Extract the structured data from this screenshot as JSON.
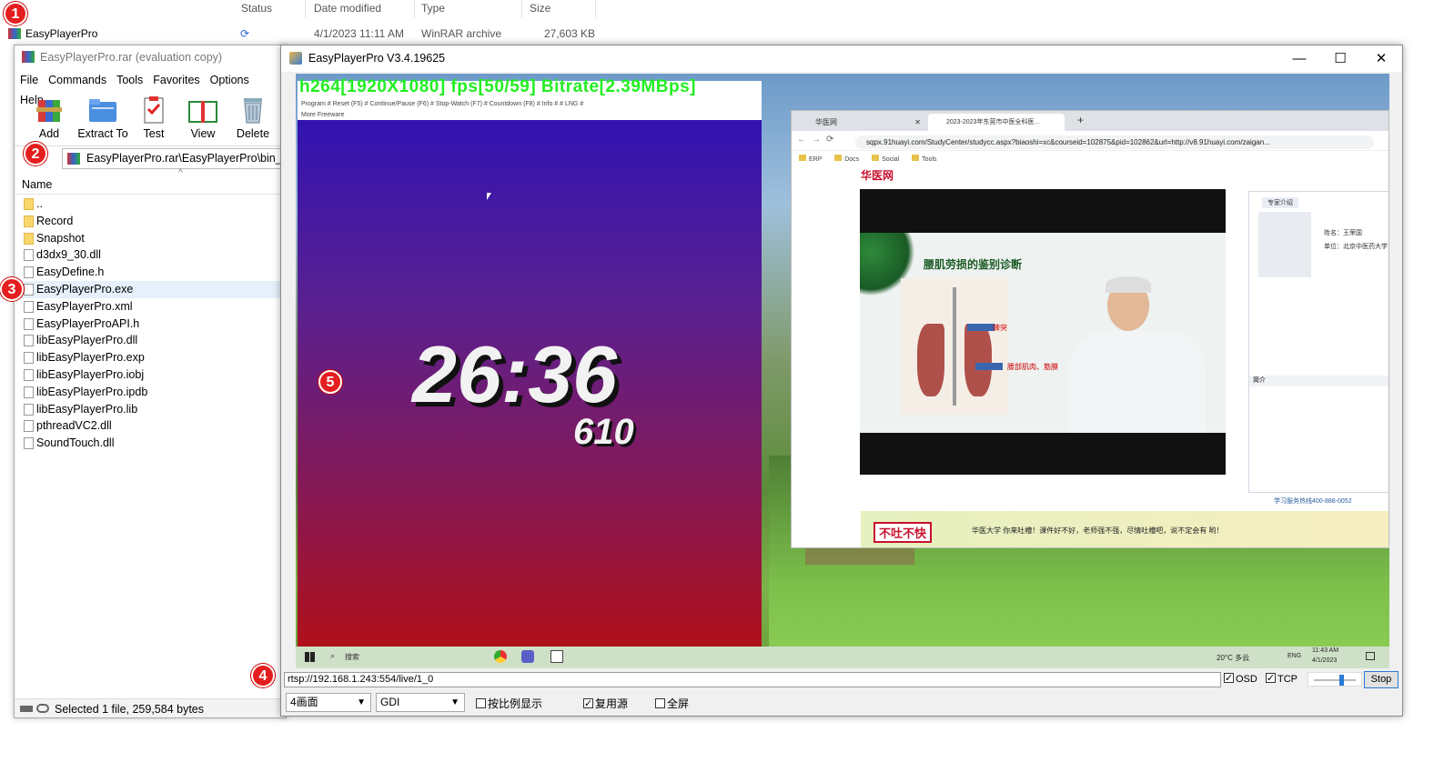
{
  "explorer": {
    "headers": {
      "status": "Status",
      "date": "Date modified",
      "type": "Type",
      "size": "Size"
    },
    "row": {
      "name": "EasyPlayerPro",
      "date": "4/1/2023 11:11 AM",
      "type": "WinRAR archive",
      "size": "27,603 KB"
    }
  },
  "winrar": {
    "title": "EasyPlayerPro.rar (evaluation copy)",
    "menu": [
      "File",
      "Commands",
      "Tools",
      "Favorites",
      "Options",
      "Help"
    ],
    "toolbar": {
      "add": "Add",
      "extract": "Extract To",
      "test": "Test",
      "view": "View",
      "delete": "Delete"
    },
    "path": "EasyPlayerPro.rar\\EasyPlayerPro\\bin_x64",
    "column": "Name",
    "files": [
      "..",
      "Record",
      "Snapshot",
      "d3dx9_30.dll",
      "EasyDefine.h",
      "EasyPlayerPro.exe",
      "EasyPlayerPro.xml",
      "EasyPlayerProAPI.h",
      "libEasyPlayerPro.dll",
      "libEasyPlayerPro.exp",
      "libEasyPlayerPro.iobj",
      "libEasyPlayerPro.ipdb",
      "libEasyPlayerPro.lib",
      "pthreadVC2.dll",
      "SoundTouch.dll"
    ],
    "status": "Selected 1 file, 259,584 bytes"
  },
  "player": {
    "title": "EasyPlayerPro V3.4.19625",
    "osd": "h264[1920X1080] fps[50/59] Bitrate[2.39MBps]",
    "clock_menu": "Program  #  Reset (F5)  #  Continue/Pause (F6)  #  Stop-Watch (F7)  #  Countdown (F8)  #  Info  #  # LNG  #",
    "clock_more": "More Freeware",
    "clock_time": "26:36",
    "clock_ms": "610",
    "browser": {
      "tab1": "华医网",
      "tab2": "2023-2023年东莞市中医全科医...",
      "url": "sqpx.91huayi.com/StudyCenter/studycc.aspx?biaoshi=xc&courseid=102875&pid=102862&url=http://v8.91huayi.com/zaigan...",
      "bookmarks": [
        "ERP",
        "Docs",
        "Social",
        "Tools"
      ],
      "logo": "华医网",
      "slide_title": "腰肌劳损的鉴别诊断",
      "label1": "棘突",
      "label2": "腰部肌肉、筋膜",
      "side_tab": "专家介绍",
      "side_name": "姓名：王荣国",
      "side_unit": "单位：北京中医药大学",
      "side_intro": "简介",
      "hotline": "学习服务热线400-888-0052",
      "banner_left": "不吐不快",
      "banner_text": "华医大学 你来吐槽！课件好不好，老师强不强，尽情吐槽吧，说不定会有 哟！"
    },
    "taskbar": {
      "search": "搜索",
      "weather": "20°C 多云",
      "lang": "ENG",
      "time": "11:43 AM",
      "date": "4/1/2023"
    },
    "url": "rtsp://192.168.1.243:554/live/1_0",
    "osd_label": "OSD",
    "tcp_label": "TCP",
    "stop": "Stop",
    "layout_select": "4画面",
    "render_select": "GDI",
    "ratio_label": "按比例显示",
    "reuse_label": "复用源",
    "fullscreen_label": "全屏"
  },
  "badges": [
    "1",
    "2",
    "3",
    "4",
    "5"
  ]
}
